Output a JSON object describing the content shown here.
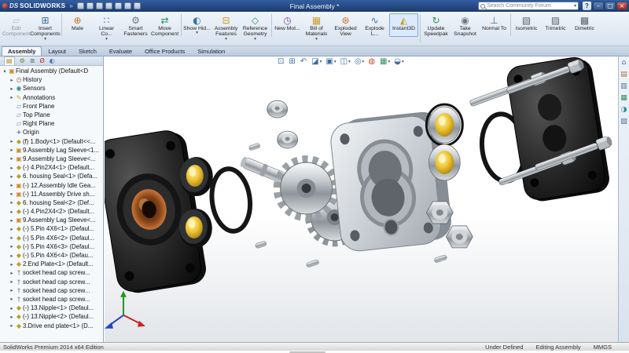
{
  "colors": {
    "titlebar_blue": "#1b3a6e",
    "ribbon_bg": "#dde7f2",
    "brass_yellow": "#eec431",
    "copper_bushing": "#b87333",
    "plate_black": "#1a1a1a"
  },
  "titlebar": {
    "logo_prefix": "DS",
    "logo_text": "SOLIDWORKS",
    "menu_expand": "»",
    "title": "Final Assembly *",
    "search_placeholder": "Search Community Forum",
    "search_dd": "▾",
    "help": "?",
    "min": "–",
    "max": "▢",
    "close": "×",
    "quick_access": [
      {
        "name": "new-document-icon"
      },
      {
        "name": "open-icon"
      },
      {
        "name": "save-icon"
      },
      {
        "name": "print-icon"
      },
      {
        "name": "undo-icon"
      },
      {
        "name": "rebuild-icon"
      },
      {
        "name": "options-icon"
      }
    ]
  },
  "ribbon": {
    "doc_min": "–",
    "doc_restore": "▢",
    "doc_close": "×",
    "buttons": [
      {
        "name": "edit-component-button",
        "icon": "edit-component-icon",
        "glyph": "▱",
        "label": "Edit Component",
        "dd": "",
        "cls": "disabled"
      },
      {
        "name": "insert-components-button",
        "icon": "insert-components-icon",
        "glyph": "⊞",
        "label": "Insert Components",
        "dd": "▾",
        "cls": ""
      },
      {
        "name": "mate-button",
        "icon": "mate-icon",
        "glyph": "⊕",
        "label": "Mate",
        "dd": "",
        "cls": "gs"
      },
      {
        "name": "linear-pattern-button",
        "icon": "linear-component-pattern-icon",
        "glyph": "∷",
        "label": "Linear Co...",
        "dd": "▾",
        "cls": ""
      },
      {
        "name": "smart-fasteners-button",
        "icon": "smart-fasteners-icon",
        "glyph": "⚙",
        "label": "Smart Fasteners",
        "dd": "",
        "cls": ""
      },
      {
        "name": "move-component-button",
        "icon": "move-component-icon",
        "glyph": "⇄",
        "label": "Move Component",
        "dd": "",
        "cls": ""
      },
      {
        "name": "show-hidden-button",
        "icon": "show-hidden-components-icon",
        "glyph": "◐",
        "label": "Show Hid...",
        "dd": "▾",
        "cls": "gs"
      },
      {
        "name": "assembly-features-button",
        "icon": "assembly-features-icon",
        "glyph": "⊟",
        "label": "Assembly Features",
        "dd": "▾",
        "cls": ""
      },
      {
        "name": "reference-geometry-button",
        "icon": "reference-geometry-icon",
        "glyph": "◇",
        "label": "Reference Geometry",
        "dd": "▾",
        "cls": ""
      },
      {
        "name": "new-motion-study-button",
        "icon": "new-motion-study-icon",
        "glyph": "◷",
        "label": "New Mot...",
        "dd": "",
        "cls": "gs"
      },
      {
        "name": "bill-of-materials-button",
        "icon": "bill-of-materials-icon",
        "glyph": "▦",
        "label": "Bill of Materials",
        "dd": "▾",
        "cls": ""
      },
      {
        "name": "exploded-view-button",
        "icon": "exploded-view-icon",
        "glyph": "⊛",
        "label": "Exploded View",
        "dd": "",
        "cls": ""
      },
      {
        "name": "explode-line-sketch-button",
        "icon": "explode-line-sketch-icon",
        "glyph": "∿",
        "label": "Explode L...",
        "dd": "",
        "cls": ""
      },
      {
        "name": "instant3d-button",
        "icon": "instant3d-icon",
        "glyph": "◭",
        "label": "Instant3D",
        "dd": "",
        "cls": "active"
      },
      {
        "name": "update-speedpak-button",
        "icon": "update-speedpak-icon",
        "glyph": "↻",
        "label": "Update Speedpak",
        "dd": "",
        "cls": "gs"
      },
      {
        "name": "take-snapshot-button",
        "icon": "take-snapshot-icon",
        "glyph": "◉",
        "label": "Take Snapshot",
        "dd": "",
        "cls": ""
      },
      {
        "name": "normal-to-button",
        "icon": "normal-to-icon",
        "glyph": "⊥",
        "label": "Normal To",
        "dd": "",
        "cls": ""
      },
      {
        "name": "isometric-button",
        "icon": "isometric-icon",
        "glyph": "▧",
        "label": "Isometric",
        "dd": "",
        "cls": "gs"
      },
      {
        "name": "trimetric-button",
        "icon": "trimetric-icon",
        "glyph": "▨",
        "label": "Trimetric",
        "dd": "",
        "cls": ""
      },
      {
        "name": "dimetric-button",
        "icon": "dimetric-icon",
        "glyph": "▩",
        "label": "Dimetric",
        "dd": "",
        "cls": ""
      }
    ]
  },
  "tabs": {
    "items": [
      {
        "name": "tab-assembly",
        "label": "Assembly",
        "cls": "active"
      },
      {
        "name": "tab-layout",
        "label": "Layout",
        "cls": ""
      },
      {
        "name": "tab-sketch",
        "label": "Sketch",
        "cls": ""
      },
      {
        "name": "tab-evaluate",
        "label": "Evaluate",
        "cls": ""
      },
      {
        "name": "tab-office-products",
        "label": "Office Products",
        "cls": ""
      },
      {
        "name": "tab-simulation",
        "label": "Simulation",
        "cls": ""
      }
    ]
  },
  "feature_tree": {
    "pane_tabs": [
      {
        "name": "featuremanager-tab",
        "glyph": "▤",
        "cls": "active"
      },
      {
        "name": "propertymanager-tab",
        "glyph": "⚙",
        "cls": ""
      },
      {
        "name": "configurationmanager-tab",
        "glyph": "≣",
        "cls": ""
      },
      {
        "name": "dimxpertmanager-tab",
        "glyph": "Ø",
        "cls": ""
      },
      {
        "name": "displaymanager-tab",
        "glyph": "◐",
        "cls": ""
      }
    ],
    "items": [
      {
        "icon": "assembly-icon",
        "glyph": "▣",
        "exp": "▾",
        "label": "Final Assembly (Default<D",
        "cls": "root"
      },
      {
        "icon": "history-icon",
        "glyph": "◷",
        "exp": "▸",
        "label": "History",
        "cls": "child"
      },
      {
        "icon": "sensors-icon",
        "glyph": "◉",
        "exp": "▸",
        "label": "Sensors",
        "cls": "child"
      },
      {
        "icon": "annotations-icon",
        "glyph": "✎",
        "exp": "▸",
        "label": "Annotations",
        "cls": "child"
      },
      {
        "icon": "plane-icon",
        "glyph": "▱",
        "exp": "",
        "label": "Front Plane",
        "cls": "child"
      },
      {
        "icon": "plane-icon",
        "glyph": "▱",
        "exp": "",
        "label": "Top Plane",
        "cls": "child"
      },
      {
        "icon": "plane-icon",
        "glyph": "▱",
        "exp": "",
        "label": "Right Plane",
        "cls": "child"
      },
      {
        "icon": "origin-icon",
        "glyph": "+",
        "exp": "",
        "label": "Origin",
        "cls": "child"
      },
      {
        "icon": "part-icon",
        "glyph": "◆",
        "exp": "▸",
        "label": "(f) 1.Body<1> (Default<<...",
        "cls": "child"
      },
      {
        "icon": "subassembly-icon",
        "glyph": "▣",
        "exp": "▸",
        "label": "9.Assembly Lag Sleeve<1...",
        "cls": "child"
      },
      {
        "icon": "subassembly-icon",
        "glyph": "▣",
        "exp": "▸",
        "label": "9.Assembly Lag Sleeve<...",
        "cls": "child"
      },
      {
        "icon": "part-icon",
        "glyph": "◆",
        "exp": "▸",
        "label": "(-) 4.Pin2X4<1> (Default...",
        "cls": "child"
      },
      {
        "icon": "part-icon",
        "glyph": "◆",
        "exp": "▸",
        "label": "6. housing Seal<1> (Defa...",
        "cls": "child"
      },
      {
        "icon": "subassembly-icon",
        "glyph": "▣",
        "exp": "▸",
        "label": "(-) 12.Assembly Idle Gea...",
        "cls": "child"
      },
      {
        "icon": "subassembly-icon",
        "glyph": "▣",
        "exp": "▸",
        "label": "(-) 11.Assembly Drive sh...",
        "cls": "child"
      },
      {
        "icon": "part-icon",
        "glyph": "◆",
        "exp": "▸",
        "label": "6. housing Seal<2> (Def...",
        "cls": "child"
      },
      {
        "icon": "part-icon",
        "glyph": "◆",
        "exp": "▸",
        "label": "(-) 4.Pin2X4<2> (Default...",
        "cls": "child"
      },
      {
        "icon": "subassembly-icon",
        "glyph": "▣",
        "exp": "▸",
        "label": "9.Assembly Lag Sleeve<...",
        "cls": "child"
      },
      {
        "icon": "part-icon",
        "glyph": "◆",
        "exp": "▸",
        "label": "(-) 5.Pin 4X6<1> (Defaul...",
        "cls": "child"
      },
      {
        "icon": "part-icon",
        "glyph": "◆",
        "exp": "▸",
        "label": "(-) 5.Pin 4X6<2> (Defaul...",
        "cls": "child"
      },
      {
        "icon": "part-icon",
        "glyph": "◆",
        "exp": "▸",
        "label": "(-) 5.Pin 4X6<3> (Defaul...",
        "cls": "child"
      },
      {
        "icon": "part-icon",
        "glyph": "◆",
        "exp": "▸",
        "label": "(-) 5.Pin 4X6<4> (Defau...",
        "cls": "child"
      },
      {
        "icon": "part-icon",
        "glyph": "◆",
        "exp": "▸",
        "label": "2.End Plate<1> (Default...",
        "cls": "child"
      },
      {
        "icon": "screw-icon",
        "glyph": "†",
        "exp": "▸",
        "label": "socket head cap screw...",
        "cls": "child"
      },
      {
        "icon": "screw-icon",
        "glyph": "†",
        "exp": "▸",
        "label": "socket head cap screw...",
        "cls": "child"
      },
      {
        "icon": "screw-icon",
        "glyph": "†",
        "exp": "▸",
        "label": "socket head cap screw...",
        "cls": "child"
      },
      {
        "icon": "screw-icon",
        "glyph": "†",
        "exp": "▸",
        "label": "socket head cap screw...",
        "cls": "child"
      },
      {
        "icon": "part-icon",
        "glyph": "◆",
        "exp": "▸",
        "label": "(-) 13.Nipple<1> (Defaul...",
        "cls": "child"
      },
      {
        "icon": "part-icon",
        "glyph": "◆",
        "exp": "▸",
        "label": "(-) 13.Nipple<2> (Defaul...",
        "cls": "child"
      },
      {
        "icon": "part-icon",
        "glyph": "◆",
        "exp": "▸",
        "label": "3.Drive end plate<1> (D...",
        "cls": "child"
      }
    ]
  },
  "viewport": {
    "headsup": [
      {
        "name": "zoom-fit-icon",
        "glyph": "⊡",
        "dd": ""
      },
      {
        "name": "zoom-area-icon",
        "glyph": "⊞",
        "dd": ""
      },
      {
        "name": "previous-view-icon",
        "glyph": "↶",
        "dd": ""
      },
      {
        "name": "section-view-icon",
        "glyph": "◪",
        "dd": "▾"
      },
      {
        "name": "view-orientation-icon",
        "glyph": "▣",
        "dd": "▾"
      },
      {
        "name": "display-style-icon",
        "glyph": "◫",
        "dd": "▾"
      },
      {
        "name": "hide-show-items-icon",
        "glyph": "◎",
        "dd": "▾"
      },
      {
        "name": "edit-appearance-icon",
        "glyph": "◍",
        "dd": ""
      },
      {
        "name": "apply-scene-icon",
        "glyph": "▦",
        "dd": "▾"
      },
      {
        "name": "view-settings-icon",
        "glyph": "◒",
        "dd": "▾"
      }
    ]
  },
  "task_pane": [
    {
      "name": "solidworks-resources-icon",
      "glyph": "⌂"
    },
    {
      "name": "design-library-icon",
      "glyph": "▤"
    },
    {
      "name": "file-explorer-icon",
      "glyph": "▥"
    },
    {
      "name": "view-palette-icon",
      "glyph": "▦"
    },
    {
      "name": "appearances-icon",
      "glyph": "◑"
    },
    {
      "name": "custom-properties-icon",
      "glyph": "▧"
    }
  ],
  "statusbar": {
    "left": "SolidWorks Premium 2014 x64 Edition",
    "status": "Under Defined",
    "mode": "Editing Assembly",
    "units": "MMGS"
  }
}
